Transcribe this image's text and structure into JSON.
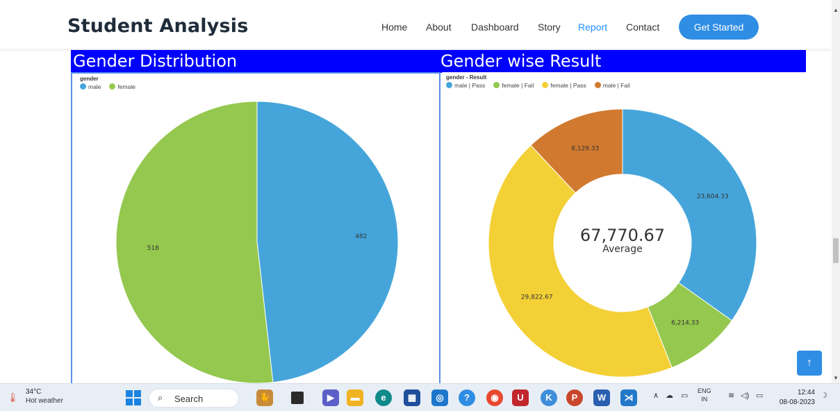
{
  "navbar": {
    "brand": "Student Analysis",
    "items": [
      "Home",
      "About",
      "Dashboard",
      "Story",
      "Report",
      "Contact"
    ],
    "active": "Report",
    "cta": "Get Started"
  },
  "sections": {
    "left_title": "Gender Distribution",
    "right_title": "Gender wise Result"
  },
  "colors": {
    "accent": "#2f8de3",
    "section_bg": "#0000ff",
    "male": "#45a5da",
    "female": "#94c84e",
    "female_pass": "#f3d035",
    "male_fail": "#d17a2f"
  },
  "chart_data": [
    {
      "type": "pie",
      "legend_title": "gender",
      "legend_position": "top-left",
      "categories": [
        "male",
        "female"
      ],
      "values": [
        482,
        518
      ],
      "labels": [
        "482",
        "518"
      ],
      "colors": [
        "#45a5da",
        "#94c84e"
      ]
    },
    {
      "type": "pie",
      "subtype": "donut",
      "legend_title": "gender - Result",
      "legend_position": "top-left",
      "categories": [
        "male | Pass",
        "female | Fail",
        "female | Pass",
        "male | Fail"
      ],
      "values": [
        23604.33,
        6214.33,
        29822.67,
        8129.33
      ],
      "labels": [
        "23,604.33",
        "6,214.33",
        "29,822.67",
        "8,129.33"
      ],
      "colors": [
        "#45a5da",
        "#94c84e",
        "#f3d035",
        "#d17a2f"
      ],
      "center_value": "67,770.67",
      "center_label": "Average"
    }
  ],
  "taskbar": {
    "temperature": "34°C",
    "weather": "Hot weather",
    "search_label": "Search",
    "lang_top": "ENG",
    "lang_bottom": "IN",
    "time": "12:44",
    "date": "08-08-2023"
  },
  "icons": {
    "back_to_top": "arrow-up-icon",
    "windows": "windows-start-icon",
    "search": "search-icon"
  }
}
